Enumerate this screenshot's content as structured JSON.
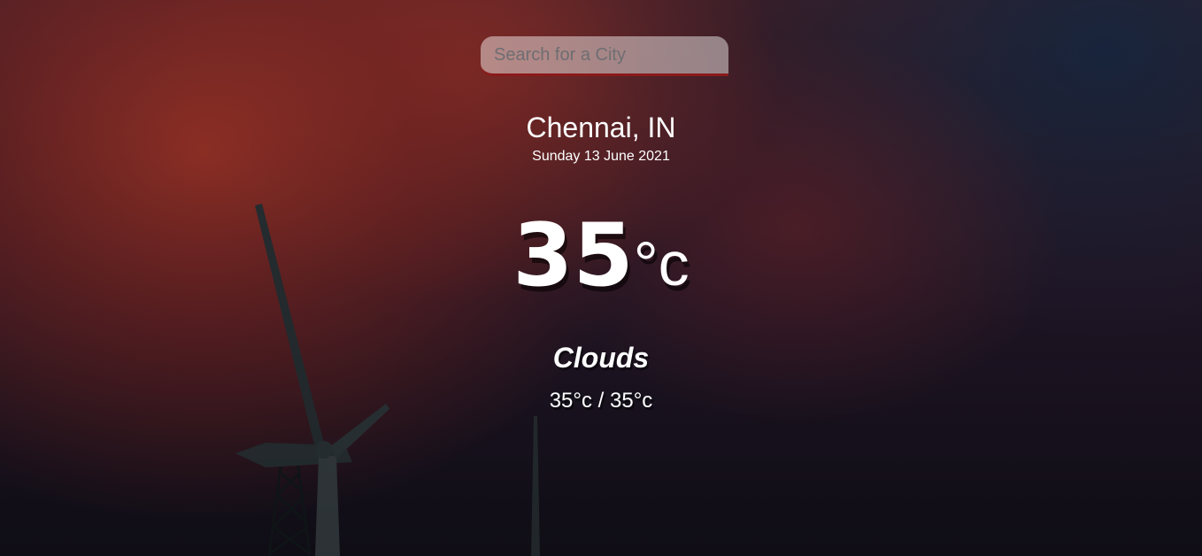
{
  "search": {
    "placeholder": "Search for a City",
    "value": ""
  },
  "location": {
    "city": "Chennai, IN",
    "date": "Sunday 13 June 2021"
  },
  "current": {
    "temperature": "35",
    "unit": "°c",
    "condition": "Clouds",
    "hi_low": "35°c / 35°c"
  },
  "colors": {
    "search_underline": "#8b1a1a",
    "text": "#ffffff"
  }
}
